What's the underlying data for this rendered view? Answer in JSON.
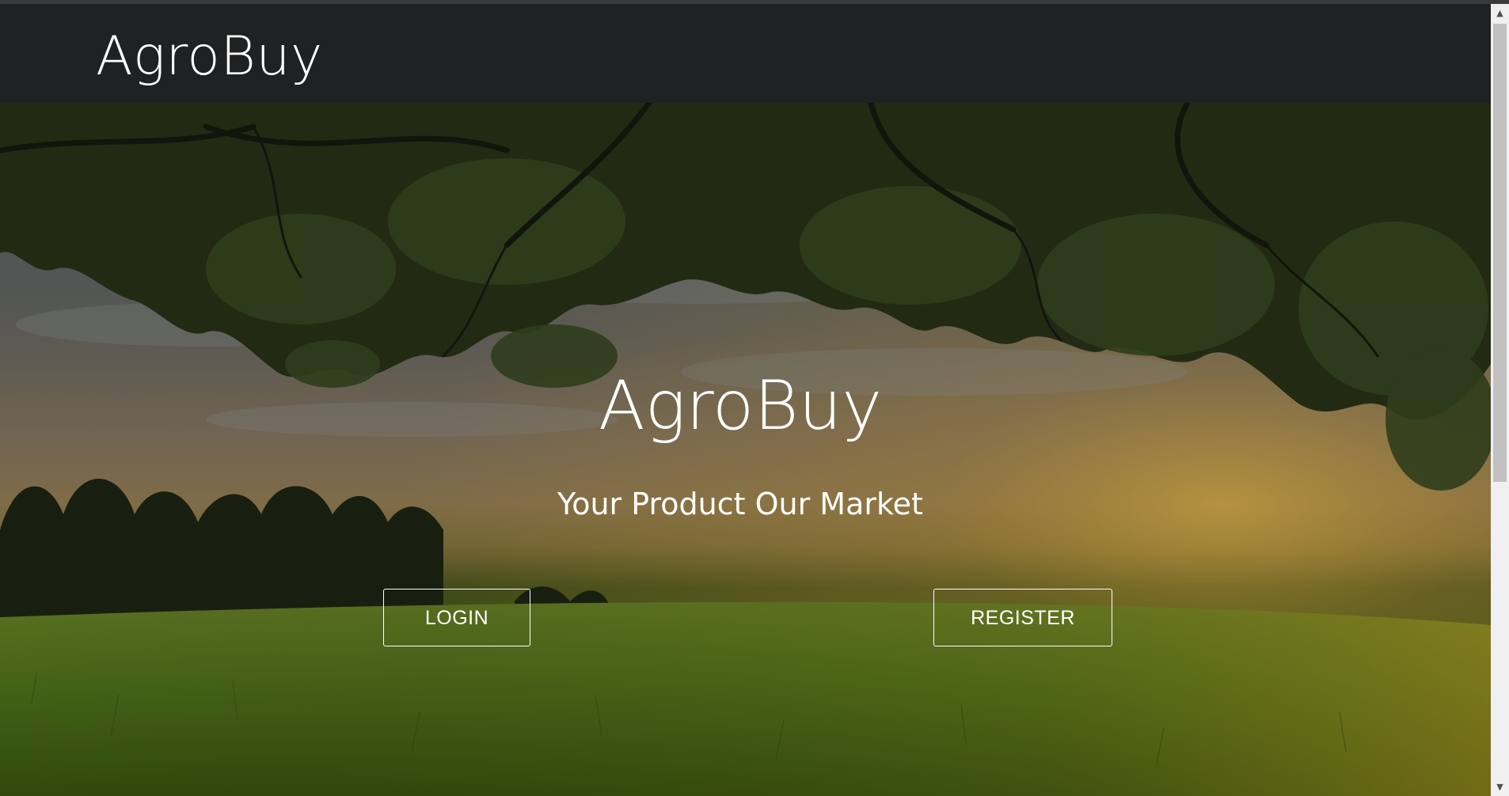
{
  "navbar": {
    "brand": "AgroBuy"
  },
  "hero": {
    "title": "AgroBuy",
    "tagline": "Your Product Our Market",
    "login_label": "LOGIN",
    "register_label": "REGISTER"
  },
  "scrollbar": {
    "up_icon": "chevron-up-icon",
    "down_icon": "chevron-down-icon"
  },
  "colors": {
    "navbar_bg": "#202122",
    "text": "#ffffff",
    "button_border": "#ffffff"
  }
}
